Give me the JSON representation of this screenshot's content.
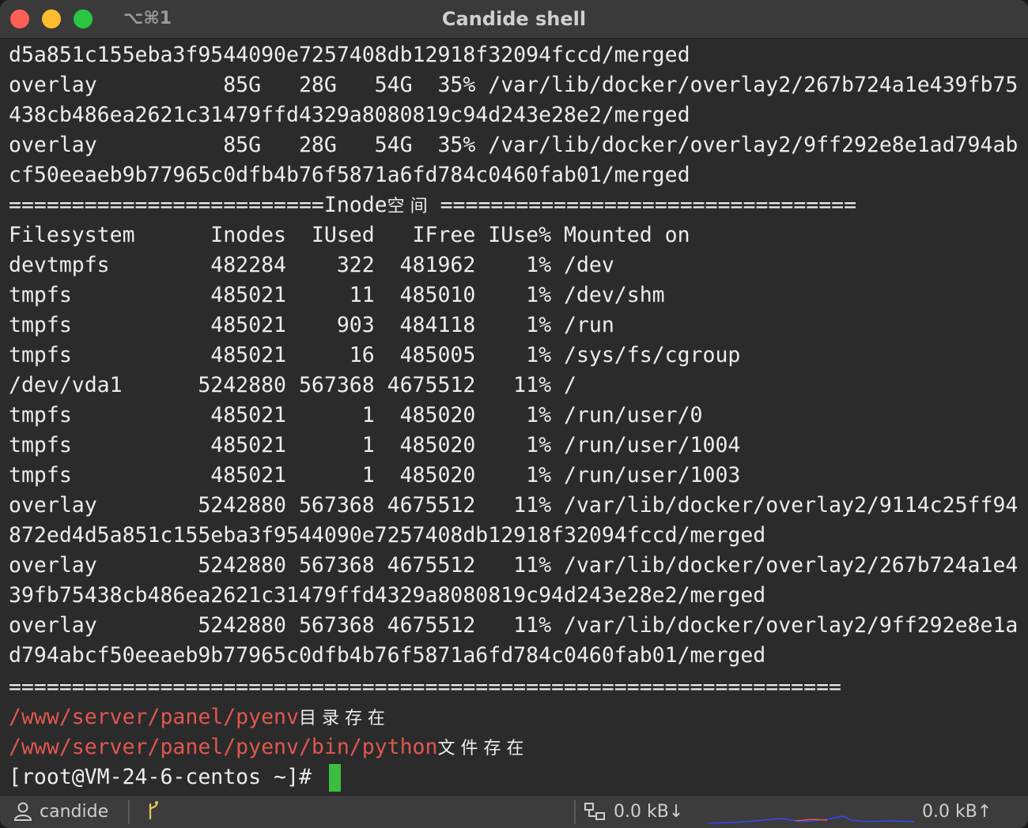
{
  "window": {
    "title": "Candide shell",
    "shortcut": "⌥⌘1"
  },
  "terminal": {
    "lines": [
      "d5a851c155eba3f9544090e7257408db12918f32094fccd/merged",
      "overlay          85G   28G   54G  35% /var/lib/docker/overlay2/267b724a1e439fb75",
      "438cb486ea2621c31479ffd4329a8080819c94d243e28e2/merged",
      "overlay          85G   28G   54G  35% /var/lib/docker/overlay2/9ff292e8e1ad794ab",
      "cf50eeaeb9b77965c0dfb4b76f5871a6fd784c0460fab01/merged"
    ],
    "inode_header_left": "=========================Inode",
    "inode_header_cjk": "空 间",
    "inode_header_right": " =================================",
    "table_lines": [
      "Filesystem      Inodes  IUsed   IFree IUse% Mounted on",
      "devtmpfs        482284    322  481962    1% /dev",
      "tmpfs           485021     11  485010    1% /dev/shm",
      "tmpfs           485021    903  484118    1% /run",
      "tmpfs           485021     16  485005    1% /sys/fs/cgroup",
      "/dev/vda1      5242880 567368 4675512   11% /",
      "tmpfs           485021      1  485020    1% /run/user/0",
      "tmpfs           485021      1  485020    1% /run/user/1004",
      "tmpfs           485021      1  485020    1% /run/user/1003",
      "overlay        5242880 567368 4675512   11% /var/lib/docker/overlay2/9114c25ff94",
      "872ed4d5a851c155eba3f9544090e7257408db12918f32094fccd/merged",
      "overlay        5242880 567368 4675512   11% /var/lib/docker/overlay2/267b724a1e4",
      "39fb75438cb486ea2621c31479ffd4329a8080819c94d243e28e2/merged",
      "overlay        5242880 567368 4675512   11% /var/lib/docker/overlay2/9ff292e8e1a",
      "d794abcf50eeaeb9b77965c0dfb4b76f5871a6fd784c0460fab01/merged"
    ],
    "separator": "==================================================================",
    "check1_path": "/www/server/panel/pyenv",
    "check1_text": "目 录 存 在",
    "check2_path": "/www/server/panel/pyenv/bin/python",
    "check2_text": "文 件 存 在",
    "prompt": "[root@VM-24-6-centos ~]# ",
    "colors": {
      "path": "#e0584f",
      "cursor": "#3dbd3d",
      "text": "#ededed"
    }
  },
  "statusbar": {
    "user_icon": "user-icon",
    "user": "candide",
    "branch_icon": "git-branch-icon",
    "network_icon": "network-icon",
    "download": "0.0 kB↓",
    "upload": "0.0 kB↑"
  }
}
